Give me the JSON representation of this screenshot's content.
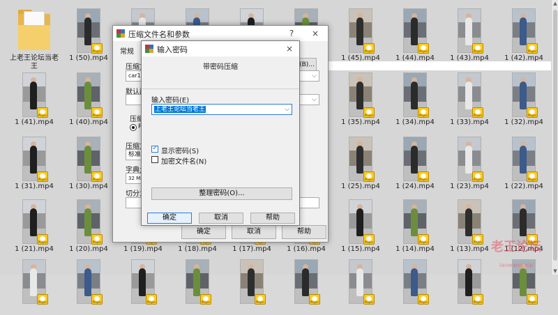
{
  "folder": {
    "name": "上老王论坛当老王"
  },
  "tiles": [
    {
      "label": "1 (50).mp4",
      "row": 0,
      "col": 1
    },
    {
      "label": "",
      "row": 0,
      "col": 2
    },
    {
      "label": "",
      "row": 0,
      "col": 3
    },
    {
      "label": "",
      "row": 0,
      "col": 4
    },
    {
      "label": "",
      "row": 0,
      "col": 5
    },
    {
      "label": "1 (45).mp4",
      "row": 0,
      "col": 6
    },
    {
      "label": "1 (44).mp4",
      "row": 0,
      "col": 7
    },
    {
      "label": "1 (43).mp4",
      "row": 0,
      "col": 8
    },
    {
      "label": "1 (42).mp4",
      "row": 0,
      "col": 9
    },
    {
      "label": "1 (41).mp4",
      "row": 1,
      "col": 0
    },
    {
      "label": "1 (40).mp4",
      "row": 1,
      "col": 1
    },
    {
      "label": "1 (35).mp4",
      "row": 1,
      "col": 6
    },
    {
      "label": "1 (34).mp4",
      "row": 1,
      "col": 7
    },
    {
      "label": "1 (33).mp4",
      "row": 1,
      "col": 8
    },
    {
      "label": "1 (32).mp4",
      "row": 1,
      "col": 9
    },
    {
      "label": "1 (31).mp4",
      "row": 2,
      "col": 0
    },
    {
      "label": "1 (30).mp4",
      "row": 2,
      "col": 1
    },
    {
      "label": "1 (25).mp4",
      "row": 2,
      "col": 6
    },
    {
      "label": "1 (24).mp4",
      "row": 2,
      "col": 7
    },
    {
      "label": "1 (23).mp4",
      "row": 2,
      "col": 8
    },
    {
      "label": "1 (22).mp4",
      "row": 2,
      "col": 9
    },
    {
      "label": "1 (21).mp4",
      "row": 3,
      "col": 0
    },
    {
      "label": "1 (20).mp4",
      "row": 3,
      "col": 1
    },
    {
      "label": "1 (19).mp4",
      "row": 3,
      "col": 2
    },
    {
      "label": "1 (18).mp4",
      "row": 3,
      "col": 3
    },
    {
      "label": "1 (17).mp4",
      "row": 3,
      "col": 4
    },
    {
      "label": "1 (16).mp4",
      "row": 3,
      "col": 5
    },
    {
      "label": "1 (15).mp4",
      "row": 3,
      "col": 6
    },
    {
      "label": "1 (14).mp4",
      "row": 3,
      "col": 7
    },
    {
      "label": "1 (13).mp4",
      "row": 3,
      "col": 8
    },
    {
      "label": "1 (12).mp4",
      "row": 3,
      "col": 9
    },
    {
      "label": "",
      "row": 4,
      "col": 0
    },
    {
      "label": "",
      "row": 4,
      "col": 1
    },
    {
      "label": "",
      "row": 4,
      "col": 2
    },
    {
      "label": "",
      "row": 4,
      "col": 3
    },
    {
      "label": "",
      "row": 4,
      "col": 4
    },
    {
      "label": "",
      "row": 4,
      "col": 5
    },
    {
      "label": "",
      "row": 4,
      "col": 6
    },
    {
      "label": "",
      "row": 4,
      "col": 7
    },
    {
      "label": "",
      "row": 4,
      "col": 8
    },
    {
      "label": "",
      "row": 4,
      "col": 9
    }
  ],
  "badge_text": "Player",
  "archive_dialog": {
    "title": "压缩文件名和参数",
    "help_glyph": "?",
    "close_glyph": "×",
    "tab_general": "常规",
    "archive_name_label": "压缩文",
    "archive_name_value": "car1.r",
    "browse_label": "(B)...",
    "default_profile_label": "默认配",
    "compress_format_label": "压缩",
    "radio_rar_label": "RA",
    "method_label": "压缩方",
    "method_value": "标准",
    "dict_label": "字典大",
    "dict_value": "32 MB",
    "split_label": "切分为",
    "ok": "确定",
    "cancel": "取消",
    "help": "帮助"
  },
  "password_dialog": {
    "title": "输入密码",
    "close_glyph": "×",
    "subtitle": "带密码压缩",
    "password_label": "输入密码(E)",
    "password_value": "上老王论坛当老王",
    "show_password": "显示密码(S)",
    "show_password_checked": true,
    "encrypt_names": "加密文件名(N)",
    "encrypt_names_checked": false,
    "organize_button": "整理密码(O)...",
    "ok": "确定",
    "cancel": "取消",
    "help": "帮助"
  },
  "watermark": {
    "main": "老王论坛",
    "sub": "laowang.vip"
  },
  "colors": {
    "accent": "#2a7ad8",
    "selection": "#0078d7",
    "badge": "#ffcc22"
  }
}
